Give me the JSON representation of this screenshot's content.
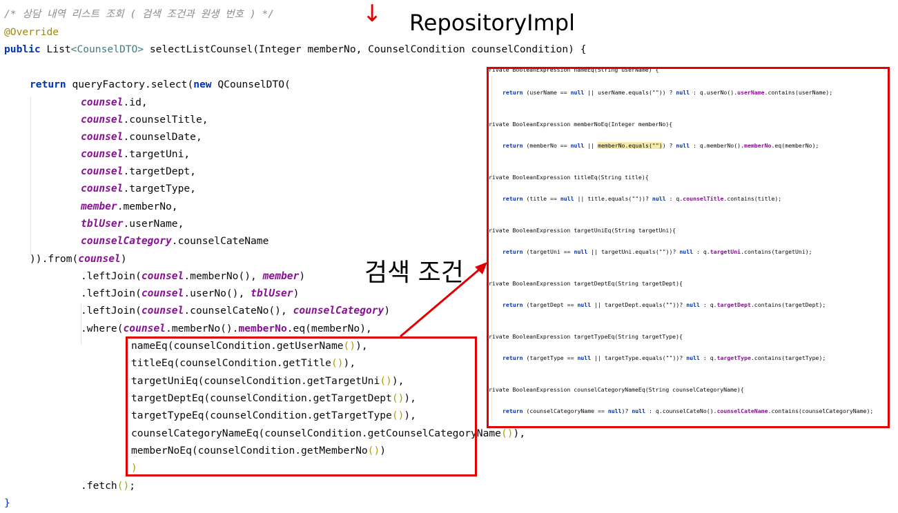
{
  "labels": {
    "repository": "RepositoryImpl",
    "search_condition": "검색 조건",
    "arrow": "↓"
  },
  "code": {
    "l01": "/* 상담 내역 리스트 조회 ( 검색 조건과 원생 번호 ) */",
    "l02": "@Override",
    "l03_kw": "public",
    "l03_a": " List",
    "l03_gen": "<CounselDTO>",
    "l03_b": " selectListCounsel(Integer memberNo, CounselCondition counselCondition) {",
    "l05_kw": "return",
    "l05_a": " queryFactory.select(",
    "l05_kw2": "new",
    "l05_b": " QCounselDTO(",
    "l06_f": "counsel",
    "l06_a": ".id,",
    "l07_f": "counsel",
    "l07_a": ".counselTitle,",
    "l08_f": "counsel",
    "l08_a": ".counselDate,",
    "l09_f": "counsel",
    "l09_a": ".targetUni,",
    "l10_f": "counsel",
    "l10_a": ".targetDept,",
    "l11_f": "counsel",
    "l11_a": ".targetType,",
    "l12_f": "member",
    "l12_a": ".memberNo,",
    "l13_f": "tblUser",
    "l13_a": ".userName,",
    "l14_f": "counselCategory",
    "l14_a": ".counselCateName",
    "l15_a": ")).from(",
    "l15_f": "counsel",
    "l15_b": ")",
    "l16_a": ".leftJoin(",
    "l16_f": "counsel",
    "l16_b": ".memberNo(), ",
    "l16_f2": "member",
    "l16_c": ")",
    "l17_a": ".leftJoin(",
    "l17_f": "counsel",
    "l17_b": ".userNo(), ",
    "l17_f2": "tblUser",
    "l17_c": ")",
    "l18_a": ".leftJoin(",
    "l18_f": "counsel",
    "l18_b": ".counselCateNo(), ",
    "l18_f2": "counselCategory",
    "l18_c": ")",
    "l19_a": ".where(",
    "l19_f": "counsel",
    "l19_b": ".memberNo().",
    "l19_f2": "memberNo",
    "l19_c": ".eq(memberNo),",
    "l20_a": "nameEq(counselCondition.getUserName",
    "l20_p": "()",
    "l20_b": "),",
    "l21_a": "titleEq(counselCondition.getTitle",
    "l21_p": "()",
    "l21_b": "),",
    "l22_a": "targetUniEq(counselCondition.getTargetUni",
    "l22_p": "()",
    "l22_b": "),",
    "l23_a": "targetDeptEq(counselCondition.getTargetDept",
    "l23_p": "()",
    "l23_b": "),",
    "l24_a": "targetTypeEq(counselCondition.getTargetType",
    "l24_p": "()",
    "l24_b": "),",
    "l25_a": "counselCategoryNameEq(counselCondition.getCounselCategoryName",
    "l25_p": "()",
    "l25_b": "),",
    "l26_a": "memberNoEq(counselCondition.getMemberNo",
    "l26_p": "()",
    "l26_b": ")",
    "l27_p": ")",
    "l28_a": ".fetch",
    "l28_p": "()",
    "l28_b": ";",
    "l29": "}"
  },
  "panel": {
    "p00_a": "rivate BooleanExpression nameEq(String userName) {",
    "p01_kw": "return",
    "p01_a": " (userName == ",
    "p01_kw2": "null",
    "p01_b": " || userName.equals(\"\")) ? ",
    "p01_kw3": "null",
    "p01_c": " : q.userNo().",
    "p01_f": "userName",
    "p01_d": ".contains(userName);",
    "p02_a": "rivate BooleanExpression memberNoEq(Integer memberNo){",
    "p03_kw": "return",
    "p03_a": " (memberNo == ",
    "p03_kw2": "null",
    "p03_b": " || ",
    "p03_hl": "memberNo.equals(\"\")",
    "p03_c": ") ? ",
    "p03_kw3": "null",
    "p03_d": " : q.memberNo().",
    "p03_f": "memberNo",
    "p03_e": ".eq(memberNo);",
    "p04_a": "rivate BooleanExpression titleEq(String title){",
    "p05_kw": "return",
    "p05_a": " (title == ",
    "p05_kw2": "null",
    "p05_b": " || title.equals(\"\"))? ",
    "p05_kw3": "null",
    "p05_c": " : q.",
    "p05_f": "counselTitle",
    "p05_d": ".contains(title);",
    "p06_a": "rivate BooleanExpression targetUniEq(String targetUni){",
    "p07_kw": "return",
    "p07_a": " (targetUni == ",
    "p07_kw2": "null",
    "p07_b": " || targetUni.equals(\"\"))? ",
    "p07_kw3": "null",
    "p07_c": " : q.",
    "p07_f": "targetUni",
    "p07_d": ".contains(targetUni);",
    "p08_a": "rivate BooleanExpression targetDeptEq(String targetDept){",
    "p09_kw": "return",
    "p09_a": " (targetDept == ",
    "p09_kw2": "null",
    "p09_b": " || targetDept.equals(\"\"))? ",
    "p09_kw3": "null",
    "p09_c": " : q.",
    "p09_f": "targetDept",
    "p09_d": ".contains(targetDept);",
    "p10_a": "rivate BooleanExpression targetTypeEq(String targetType){",
    "p11_kw": "return",
    "p11_a": " (targetType == ",
    "p11_kw2": "null",
    "p11_b": " || targetType.equals(\"\"))? ",
    "p11_kw3": "null",
    "p11_c": " : q.",
    "p11_f": "targetType",
    "p11_d": ".contains(targetType);",
    "p12_a": "rivate BooleanExpression counselCategoryNameEq(String counselCategoryName){",
    "p13_kw": "return",
    "p13_a": " (counselCategoryName == ",
    "p13_kw2": "null",
    "p13_b": ")? ",
    "p13_kw3": "null",
    "p13_c": " : q.counselCateNo().",
    "p13_f": "counselCateName",
    "p13_d": ".contains(counselCategoryName);"
  },
  "colors": {
    "highlight_box": "#e00000",
    "keyword": "#0033b3",
    "field": "#871094",
    "comment": "#8c8c8c",
    "annotation": "#9e880d"
  }
}
